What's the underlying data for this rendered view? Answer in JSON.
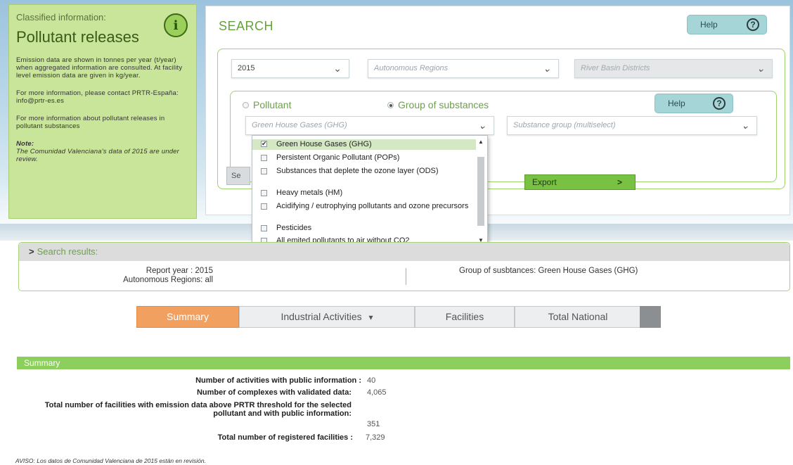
{
  "info_panel": {
    "classified": "Classified information:",
    "title": "Pollutant releases",
    "logo_icon": "info-badge-icon",
    "p1": "Emission data are shown in tonnes per year (t/year) when aggregated information are consulted. At facility level emission data are given in kg/year.",
    "p2": "For more information, please contact PRTR-España: info@prtr-es.es",
    "p3": "For more information about pollutant releases in pollutant substances",
    "note_label": "Note:",
    "note_text": "The Comunidad Valenciana's data of 2015 are under review."
  },
  "search": {
    "header": "SEARCH",
    "help_label": "Help",
    "help_inner_label": "Help",
    "year": "2015",
    "autonomous_regions_placeholder": "Autonomous Regions",
    "river_basin_placeholder": "River Basin Districts",
    "radio_pollutant": "Pollutant",
    "radio_group": "Group of substances",
    "group_selected": "Green House Gases (GHG)",
    "substance_group_placeholder": "Substance group (multiselect)",
    "search_button_stub": "Se",
    "export_label": "Export",
    "export_arrow": ">"
  },
  "dropdown": {
    "items": [
      {
        "label": "Green House Gases (GHG)",
        "checked": true
      },
      {
        "label": "Persistent Organic Pollutant (POPs)",
        "checked": false
      },
      {
        "label": "Substances that deplete the ozone layer (ODS)",
        "checked": false
      },
      {
        "label": "Heavy metals (HM)",
        "checked": false
      },
      {
        "label": "Acidifying / eutrophying pollutants and ozone precursors",
        "checked": false
      },
      {
        "label": "Pesticides",
        "checked": false
      },
      {
        "label": "All emited pollutants to air without CO2",
        "checked": false
      }
    ]
  },
  "results": {
    "title": "Search results:",
    "report_year": "Report year : 2015",
    "autonomous_regions": "Autonomous Regions: all",
    "group": "Group of susbtances: Green House Gases (GHG)"
  },
  "tabs": {
    "summary": "Summary",
    "industrial": "Industrial Activities",
    "facilities": "Facilities",
    "total_national": "Total National"
  },
  "summary": {
    "title": "Summary",
    "rows": [
      {
        "label": "Number of activities with public information :",
        "value": "40"
      },
      {
        "label": "Number of complexes with validated data:",
        "value": "4,065"
      },
      {
        "label": "Total number of facilities with emission data above PRTR threshold for the selected pollutant and with public information:",
        "value": "351"
      },
      {
        "label": "Total number of registered facilities :",
        "value": "7,329"
      }
    ],
    "aviso_prefix": "AVISO:",
    "aviso_text": "Los datos de Comunidad Valenciana de 2015 están en revisión."
  },
  "colors": {
    "green_accent": "#6ba14a",
    "info_bg": "#c8e59a",
    "tab_active": "#f2a05f",
    "help_bg": "#a6d5d8"
  }
}
